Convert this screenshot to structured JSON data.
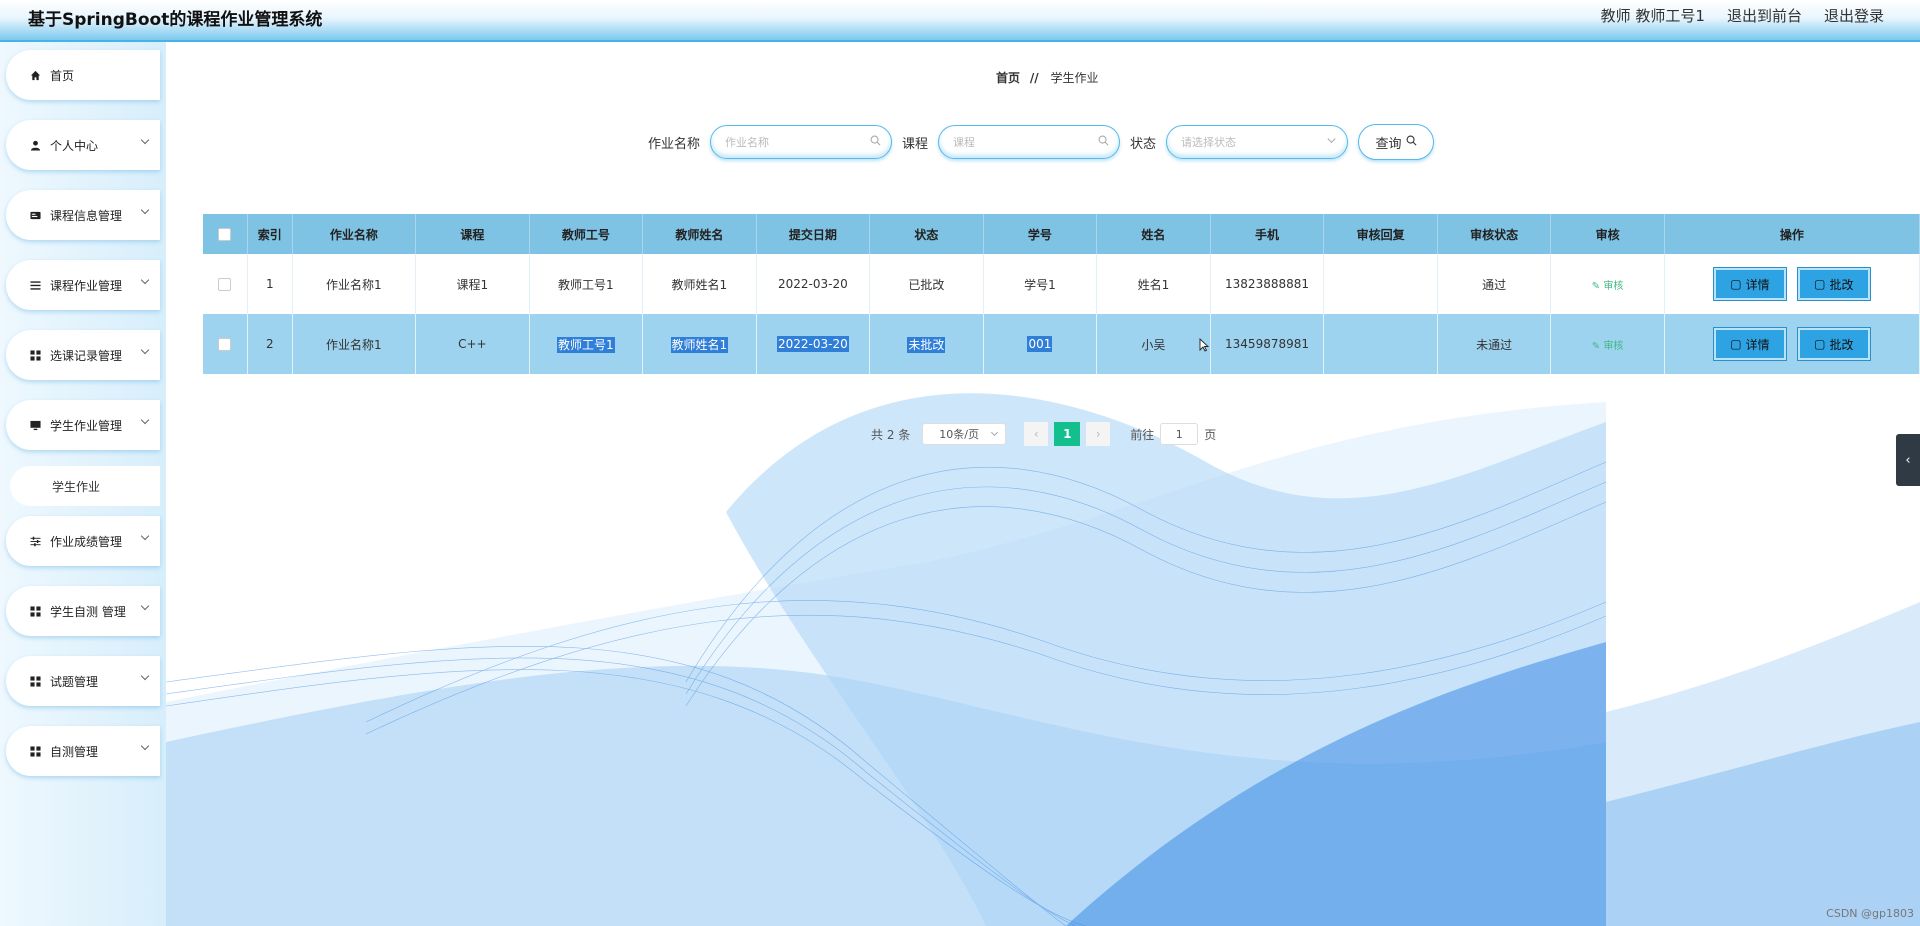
{
  "app": {
    "title": "基于SpringBoot的课程作业管理系统"
  },
  "header": {
    "user": "教师 教师工号1",
    "front": "退出到前台",
    "logout": "退出登录"
  },
  "sidebar": {
    "items": [
      {
        "label": "首页",
        "icon": "home-icon"
      },
      {
        "label": "个人中心",
        "icon": "user-icon"
      },
      {
        "label": "课程信息管理",
        "icon": "card-icon"
      },
      {
        "label": "课程作业管理",
        "icon": "list-icon"
      },
      {
        "label": "选课记录管理",
        "icon": "grid-icon"
      },
      {
        "label": "学生作业管理",
        "icon": "monitor-icon"
      },
      {
        "label": "作业成绩管理",
        "icon": "sliders-icon"
      },
      {
        "label": "学生自测 管理",
        "icon": "grid-icon"
      },
      {
        "label": "试题管理",
        "icon": "grid-icon"
      },
      {
        "label": "自测管理",
        "icon": "grid-icon"
      }
    ],
    "sub_item": "学生作业"
  },
  "breadcrumb": {
    "home": "首页",
    "sep": "//",
    "current": "学生作业"
  },
  "search": {
    "name_label": "作业名称",
    "name_placeholder": "作业名称",
    "course_label": "课程",
    "course_placeholder": "课程",
    "status_label": "状态",
    "status_placeholder": "请选择状态",
    "query": "查询"
  },
  "table": {
    "headers": [
      "索引",
      "作业名称",
      "课程",
      "教师工号",
      "教师姓名",
      "提交日期",
      "状态",
      "学号",
      "姓名",
      "手机",
      "审核回复",
      "审核状态",
      "审核",
      "操作"
    ],
    "rows": [
      {
        "index": "1",
        "name": "作业名称1",
        "course": "课程1",
        "teacher_no": "教师工号1",
        "teacher_name": "教师姓名1",
        "date": "2022-03-20",
        "status": "已批改",
        "student_no": "学号1",
        "student_name": "姓名1",
        "phone": "13823888881",
        "reply": "",
        "audit_status": "通过"
      },
      {
        "index": "2",
        "name": "作业名称1",
        "course": "C++",
        "teacher_no": "教师工号1",
        "teacher_name": "教师姓名1",
        "date": "2022-03-20",
        "status": "未批改",
        "student_no": "001",
        "student_name": "小吴",
        "phone": "13459878981",
        "reply": "",
        "audit_status": "未通过"
      }
    ],
    "audit_link": "审核",
    "detail": "详情",
    "grade": "批改"
  },
  "pager": {
    "total": "共 2 条",
    "size": "10条/页",
    "page": "1",
    "goto": "前往",
    "goto_value": "1",
    "page_unit": "页"
  },
  "footer": {
    "watermark": "CSDN @gp1803"
  },
  "colors": {
    "header_bar": "#7fc3e4",
    "accent": "#2ea3e3",
    "page_active": "#13c08d",
    "audit_green": "#42b983"
  }
}
